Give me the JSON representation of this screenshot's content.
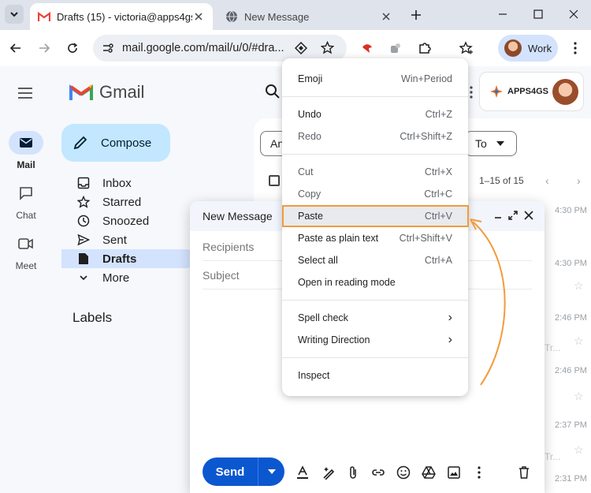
{
  "browser": {
    "tabs": [
      {
        "title": "Drafts (15) - victoria@apps4gs.c",
        "active": true
      },
      {
        "title": "New Message",
        "active": false
      }
    ],
    "url": "mail.google.com/mail/u/0/#dra...",
    "profile_label": "Work"
  },
  "gmail": {
    "logo_text": "Gmail",
    "rail": [
      {
        "label": "Mail",
        "icon": "mail-icon",
        "active": true
      },
      {
        "label": "Chat",
        "icon": "chat-icon",
        "active": false
      },
      {
        "label": "Meet",
        "icon": "video-icon",
        "active": false
      }
    ],
    "compose_label": "Compose",
    "nav": [
      {
        "label": "Inbox",
        "icon": "inbox-icon"
      },
      {
        "label": "Starred",
        "icon": "star-icon"
      },
      {
        "label": "Snoozed",
        "icon": "clock-icon"
      },
      {
        "label": "Sent",
        "icon": "send-icon"
      },
      {
        "label": "Drafts",
        "icon": "draft-icon",
        "active": true
      },
      {
        "label": "More",
        "icon": "chevron-down-icon"
      }
    ],
    "labels_heading": "Labels",
    "workspace_badge": "APPS4GS",
    "chips": [
      "An",
      "To"
    ],
    "pager": "1–15 of 15",
    "rows": [
      {
        "time": "4:30 PM",
        "snippet": ""
      },
      {
        "time": "4:30 PM",
        "snippet": ""
      },
      {
        "time": "2:46 PM",
        "snippet": "Tr..."
      },
      {
        "time": "2:46 PM",
        "snippet": ""
      },
      {
        "time": "2:37 PM",
        "snippet": "Tr..."
      },
      {
        "time": "2:31 PM",
        "snippet": ""
      }
    ]
  },
  "composer": {
    "title": "New Message",
    "recipients_placeholder": "Recipients",
    "subject_placeholder": "Subject",
    "send_label": "Send"
  },
  "context_menu": {
    "items": [
      {
        "label": "Emoji",
        "shortcut": "Win+Period"
      },
      {
        "label": "Undo",
        "shortcut": "Ctrl+Z"
      },
      {
        "label": "Redo",
        "shortcut": "Ctrl+Shift+Z",
        "disabled": true
      },
      {
        "label": "Cut",
        "shortcut": "Ctrl+X",
        "disabled": true
      },
      {
        "label": "Copy",
        "shortcut": "Ctrl+C",
        "disabled": true
      },
      {
        "label": "Paste",
        "shortcut": "Ctrl+V",
        "highlighted": true
      },
      {
        "label": "Paste as plain text",
        "shortcut": "Ctrl+Shift+V"
      },
      {
        "label": "Select all",
        "shortcut": "Ctrl+A"
      },
      {
        "label": "Open in reading mode",
        "shortcut": ""
      },
      {
        "label": "Spell check",
        "shortcut": "›"
      },
      {
        "label": "Writing Direction",
        "shortcut": "›"
      },
      {
        "label": "Inspect",
        "shortcut": ""
      }
    ]
  },
  "annotation_color": "#f29b3a"
}
